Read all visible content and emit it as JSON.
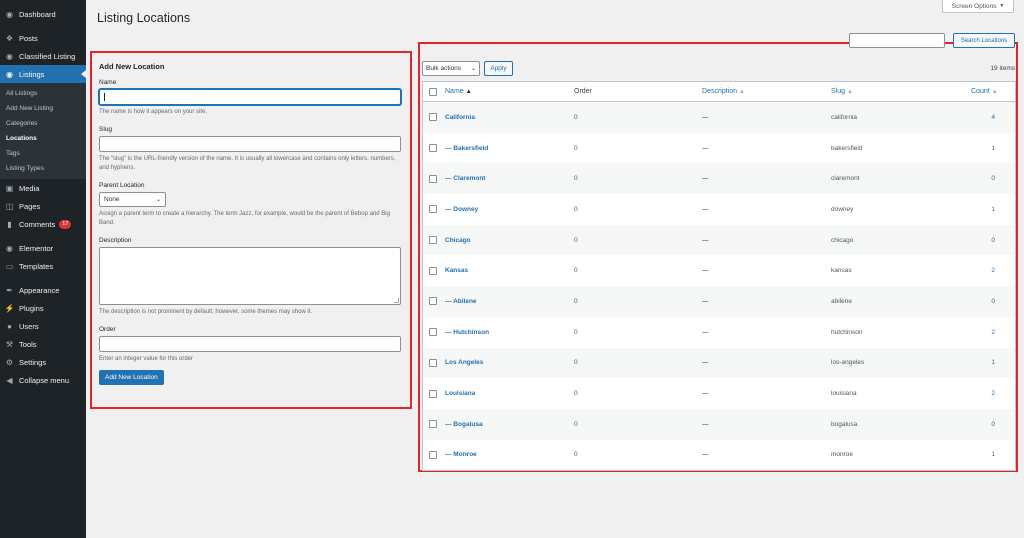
{
  "sidebar": {
    "top": [
      {
        "label": "Dashboard",
        "icon": "dashboard-icon"
      }
    ],
    "items": [
      {
        "label": "Posts",
        "icon": "pin-icon"
      },
      {
        "label": "Classified Listing",
        "icon": "location-pin-icon"
      },
      {
        "label": "Listings",
        "icon": "location-pin-icon",
        "active": true
      }
    ],
    "submenu": [
      "All Listings",
      "Add New Listing",
      "Categories",
      "Locations",
      "Tags",
      "Listing Types"
    ],
    "submenu_current": "Locations",
    "items2": [
      {
        "label": "Media",
        "icon": "media-icon"
      },
      {
        "label": "Pages",
        "icon": "pages-icon"
      },
      {
        "label": "Comments",
        "icon": "comments-icon",
        "badge": "17"
      }
    ],
    "items3": [
      {
        "label": "Elementor",
        "icon": "elementor-icon"
      },
      {
        "label": "Templates",
        "icon": "folder-icon"
      }
    ],
    "items4": [
      {
        "label": "Appearance",
        "icon": "brush-icon"
      },
      {
        "label": "Plugins",
        "icon": "plug-icon"
      },
      {
        "label": "Users",
        "icon": "users-icon"
      },
      {
        "label": "Tools",
        "icon": "wrench-icon"
      },
      {
        "label": "Settings",
        "icon": "settings-icon"
      },
      {
        "label": "Collapse menu",
        "icon": "collapse-icon"
      }
    ]
  },
  "header": {
    "title": "Listing Locations",
    "screen_options": "Screen Options"
  },
  "form": {
    "heading": "Add New Location",
    "name_label": "Name",
    "name_value": "",
    "name_help": "The name is how it appears on your site.",
    "slug_label": "Slug",
    "slug_value": "",
    "slug_help": "The “slug” is the URL-friendly version of the name. It is usually all lowercase and contains only letters, numbers, and hyphens.",
    "parent_label": "Parent Location",
    "parent_value": "None",
    "parent_help": "Assign a parent term to create a hierarchy. The term Jazz, for example, would be the parent of Bebop and Big Band.",
    "description_label": "Description",
    "description_value": "",
    "description_help": "The description is not prominent by default; however, some themes may show it.",
    "order_label": "Order",
    "order_value": "",
    "order_help": "Enter an integer value for this order",
    "submit_label": "Add New Location"
  },
  "list": {
    "search_button": "Search Locations",
    "search_value": "",
    "bulk_actions": "Bulk actions",
    "apply": "Apply",
    "items_count": "19 items",
    "columns": {
      "name": "Name",
      "order": "Order",
      "description": "Description",
      "slug": "Slug",
      "count": "Count"
    },
    "rows": [
      {
        "name": "California",
        "order": "0",
        "description": "—",
        "slug": "california",
        "count": "4"
      },
      {
        "name": "— Bakersfield",
        "order": "0",
        "description": "—",
        "slug": "bakersfield",
        "count": "1"
      },
      {
        "name": "— Claremont",
        "order": "0",
        "description": "—",
        "slug": "claremont",
        "count": "0"
      },
      {
        "name": "— Downey",
        "order": "0",
        "description": "—",
        "slug": "downey",
        "count": "1"
      },
      {
        "name": "Chicago",
        "order": "0",
        "description": "—",
        "slug": "chicago",
        "count": "0"
      },
      {
        "name": "Kansas",
        "order": "0",
        "description": "—",
        "slug": "kansas",
        "count": "2"
      },
      {
        "name": "— Abilene",
        "order": "0",
        "description": "—",
        "slug": "abilene",
        "count": "0"
      },
      {
        "name": "— Hutchinson",
        "order": "0",
        "description": "—",
        "slug": "hutchinson",
        "count": "2"
      },
      {
        "name": "Los Angeles",
        "order": "0",
        "description": "—",
        "slug": "los-angeles",
        "count": "1"
      },
      {
        "name": "Louisiana",
        "order": "0",
        "description": "—",
        "slug": "louisiana",
        "count": "2"
      },
      {
        "name": "— Bogalusa",
        "order": "0",
        "description": "—",
        "slug": "bogalusa",
        "count": "0"
      },
      {
        "name": "— Monroe",
        "order": "0",
        "description": "—",
        "slug": "monroe",
        "count": "1"
      }
    ]
  },
  "colors": {
    "accent": "#2271b1",
    "sidebar": "#1d2327",
    "highlight_border": "#e0252f",
    "badge": "#d63638"
  }
}
